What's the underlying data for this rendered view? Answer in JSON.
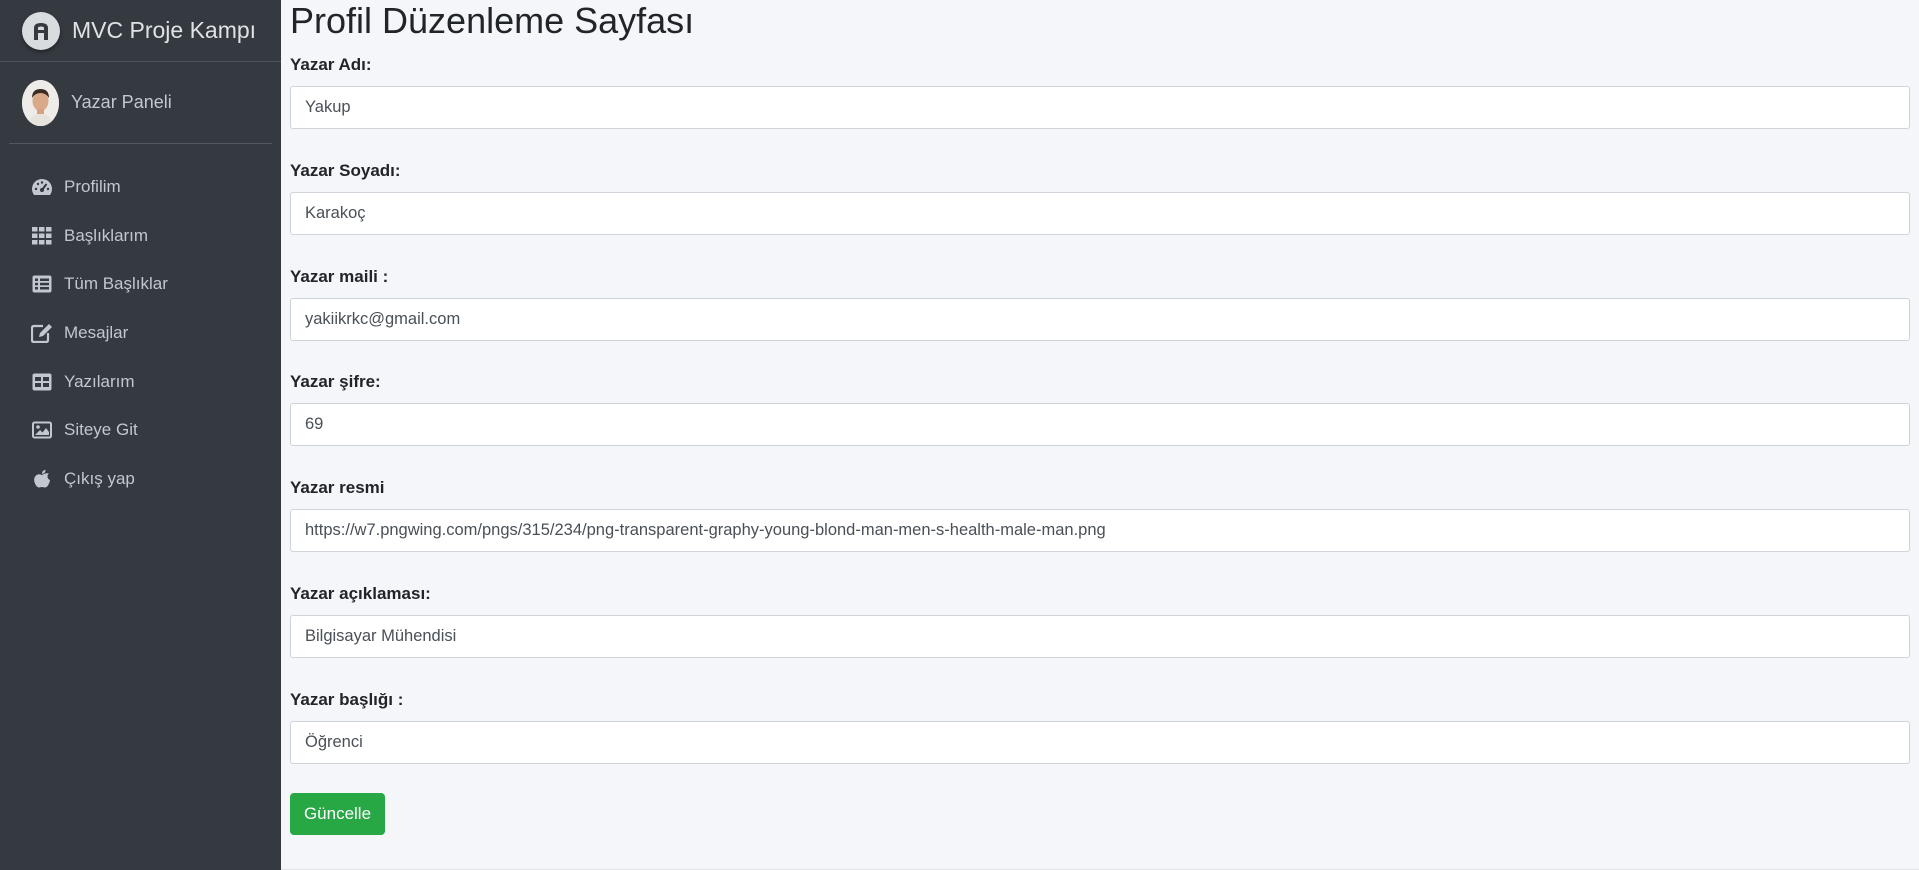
{
  "brand": {
    "name": "MVC Proje Kampı"
  },
  "user_panel": {
    "name": "Yazar Paneli"
  },
  "nav": {
    "items": [
      {
        "label": "Profilim",
        "icon": "speedometer-icon"
      },
      {
        "label": "Başlıklarım",
        "icon": "grid-icon"
      },
      {
        "label": "Tüm Başlıklar",
        "icon": "list-icon"
      },
      {
        "label": "Mesajlar",
        "icon": "edit-icon"
      },
      {
        "label": "Yazılarım",
        "icon": "table-icon"
      },
      {
        "label": "Siteye Git",
        "icon": "image-icon"
      },
      {
        "label": "Çıkış yap",
        "icon": "apple-icon"
      }
    ]
  },
  "page": {
    "title": "Profil Düzenleme Sayfası"
  },
  "form": {
    "first_name": {
      "label": "Yazar Adı:",
      "value": "Yakup"
    },
    "last_name": {
      "label": "Yazar Soyadı:",
      "value": "Karakoç"
    },
    "email": {
      "label": "Yazar maili :",
      "value": "yakiikrkc@gmail.com"
    },
    "password": {
      "label": "Yazar şifre:",
      "value": "69"
    },
    "image": {
      "label": "Yazar resmi",
      "value": "https://w7.pngwing.com/pngs/315/234/png-transparent-graphy-young-blond-man-men-s-health-male-man.png"
    },
    "about": {
      "label": "Yazar açıklaması:",
      "value": "Bilgisayar Mühendisi"
    },
    "title": {
      "label": "Yazar başlığı :",
      "value": "Öğrenci"
    },
    "submit_label": "Güncelle"
  },
  "colors": {
    "sidebar_bg": "#343a40",
    "content_bg": "#f4f6f9",
    "button_bg": "#28a745"
  }
}
